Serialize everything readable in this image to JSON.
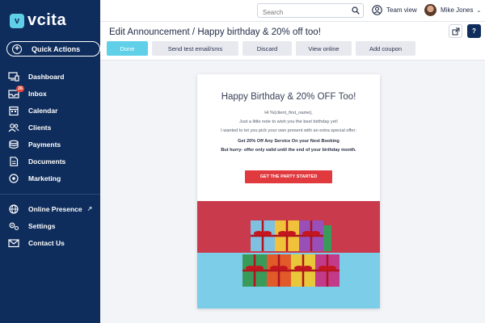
{
  "brand": {
    "logo_text": "vcita",
    "accent": "#5fd0e8",
    "sidebar_bg": "#0f2d5c"
  },
  "sidebar": {
    "quick_actions": "Quick Actions",
    "items": [
      {
        "label": "Dashboard",
        "icon": "dashboard-icon"
      },
      {
        "label": "Inbox",
        "icon": "inbox-icon",
        "badge": "26"
      },
      {
        "label": "Calendar",
        "icon": "calendar-icon"
      },
      {
        "label": "Clients",
        "icon": "clients-icon"
      },
      {
        "label": "Payments",
        "icon": "payments-icon"
      },
      {
        "label": "Documents",
        "icon": "documents-icon"
      },
      {
        "label": "Marketing",
        "icon": "marketing-icon"
      }
    ],
    "bottom_items": [
      {
        "label": "Online Presence",
        "icon": "globe-icon",
        "external": true
      },
      {
        "label": "Settings",
        "icon": "settings-icon"
      },
      {
        "label": "Contact Us",
        "icon": "mail-icon"
      }
    ]
  },
  "topbar": {
    "search_placeholder": "Search",
    "team_view": "Team view",
    "user_name": "Mike Jones"
  },
  "header": {
    "title": "Edit Announcement / Happy birthday & 20% off too!",
    "buttons": {
      "done": "Done",
      "send_test": "Send test email/sms",
      "discard": "Discard",
      "view_online": "View online",
      "add_coupon": "Add coupon"
    }
  },
  "preview": {
    "title": "Happy Birthday & 20% OFF Too!",
    "greeting": "Hi %{client_first_name},",
    "line1": "Just a little note to wish you the best birthday yet!",
    "line2": "I wanted to let you pick your own present with an extra special offer:",
    "offer": "Get 20% Off Any Service On your Next Booking",
    "hurry": "But hurry- offer only valid until the end of your birthday month.",
    "cta": "GET THE PARTY STARTED"
  }
}
